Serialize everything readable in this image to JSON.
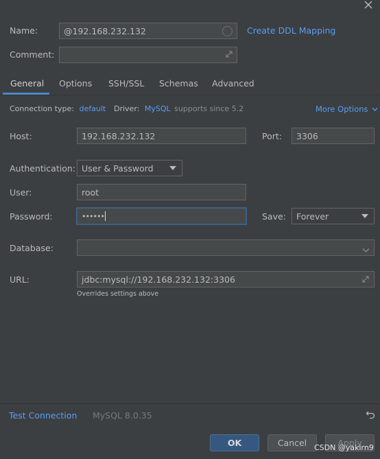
{
  "name": {
    "label": "Name:",
    "value": "@192.168.232.132",
    "ddl_link": "Create DDL Mapping"
  },
  "comment": {
    "label": "Comment:",
    "value": ""
  },
  "tabs": [
    {
      "label": "General",
      "active": true
    },
    {
      "label": "Options"
    },
    {
      "label": "SSH/SSL"
    },
    {
      "label": "Schemas"
    },
    {
      "label": "Advanced"
    }
  ],
  "connection": {
    "type_label": "Connection type:",
    "type_value": "default",
    "driver_label": "Driver:",
    "driver_value": "MySQL",
    "driver_note": "supports since 5.2",
    "more_options": "More Options"
  },
  "host": {
    "label": "Host:",
    "value": "192.168.232.132"
  },
  "port": {
    "label": "Port:",
    "value": "3306"
  },
  "auth": {
    "label": "Authentication:",
    "value": "User & Password"
  },
  "user": {
    "label": "User:",
    "value": "root"
  },
  "password": {
    "label": "Password:",
    "value": "••••••"
  },
  "save": {
    "label": "Save:",
    "value": "Forever"
  },
  "database": {
    "label": "Database:",
    "value": ""
  },
  "url": {
    "label": "URL:",
    "value": "jdbc:mysql://192.168.232.132:3306",
    "hint": "Overrides settings above"
  },
  "footer": {
    "test_connection": "Test Connection",
    "server_version": "MySQL 8.0.35",
    "ok": "OK",
    "cancel": "Cancel",
    "apply": "Apply"
  },
  "watermark": "CSDN @yakirn9",
  "colors": {
    "accent": "#589df6",
    "background": "#3c3f41",
    "field": "#45494a",
    "ok_button": "#365880"
  }
}
